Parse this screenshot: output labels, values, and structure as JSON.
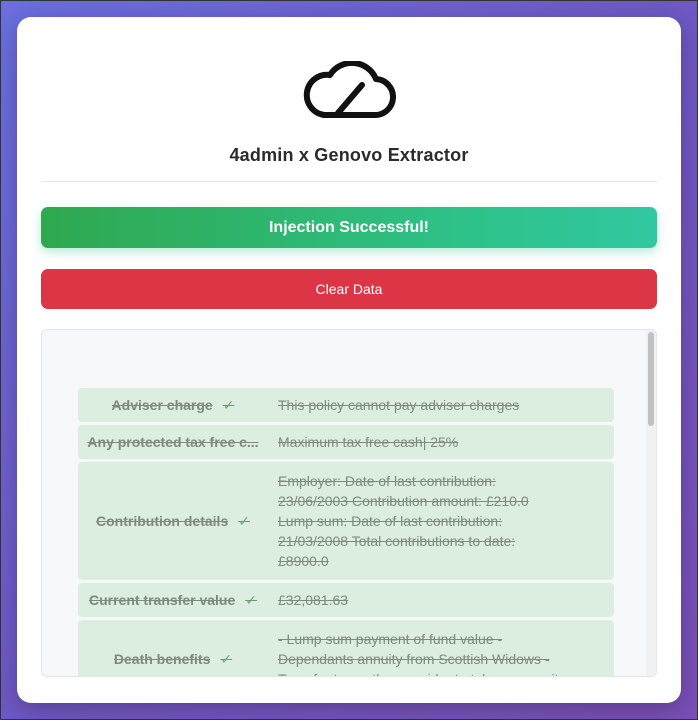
{
  "app": {
    "title": "4admin x Genovo Extractor",
    "logo_icon": "cloud-slash-icon"
  },
  "actions": {
    "success_label": "Injection Successful!",
    "clear_label": "Clear Data"
  },
  "rows": [
    {
      "label": "Adviser charge",
      "value_lines": [
        "This policy cannot pay adviser charges"
      ]
    },
    {
      "label": "Any protected tax free c...",
      "value_lines": [
        "Maximum tax free cash| 25%"
      ]
    },
    {
      "label": "Contribution details",
      "value_lines": [
        "Employer: Date of last contribution:",
        "23/06/2003 Contribution amount: £210.0",
        "Lump sum: Date of last contribution:",
        "21/03/2008 Total contributions to date:",
        "£8900.0"
      ]
    },
    {
      "label": "Current transfer value",
      "value_lines": [
        "£32,081.63"
      ]
    },
    {
      "label": "Death benefits",
      "value_lines": [
        "- Lump sum payment of fund value -",
        "Dependants annuity from Scottish Widows -",
        "Transfer to another provider to take an annuity"
      ]
    }
  ],
  "colors": {
    "success_start": "#2fa84f",
    "success_end": "#31c7a0",
    "danger": "#dc3545",
    "row_bg": "#dbeee0",
    "check": "#5cb874"
  }
}
